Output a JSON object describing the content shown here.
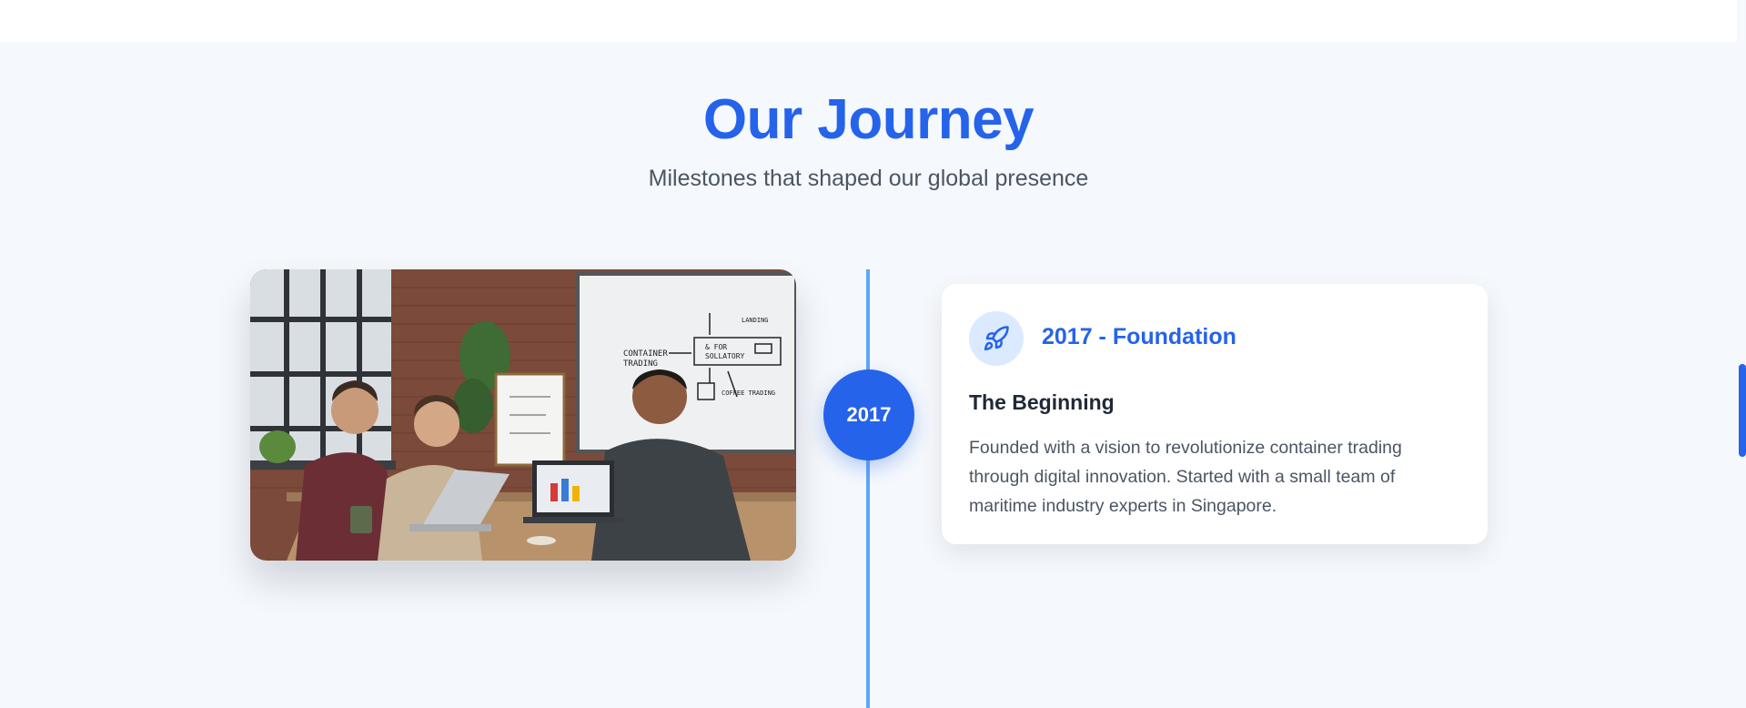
{
  "section": {
    "title": "Our Journey",
    "subtitle": "Milestones that shaped our global presence"
  },
  "timeline": {
    "year": "2017",
    "card": {
      "icon": "rocket-icon",
      "heading": "2017 - Foundation",
      "title": "The Beginning",
      "description": "Founded with a vision to revolutionize container trading through digital innovation. Started with a small team of maritime industry experts in Singapore."
    },
    "photo": {
      "whiteboard_lines": [
        "CONTAINER",
        "TRADING",
        "& FOR",
        "SOLLATORY",
        "COFFEE TRADING",
        "LANDING"
      ]
    }
  },
  "colors": {
    "accent": "#2563eb",
    "timeline_line": "#60a5fa",
    "icon_bg": "#dbeafe",
    "text_dark": "#1f2937",
    "text_muted": "#4b5563"
  }
}
